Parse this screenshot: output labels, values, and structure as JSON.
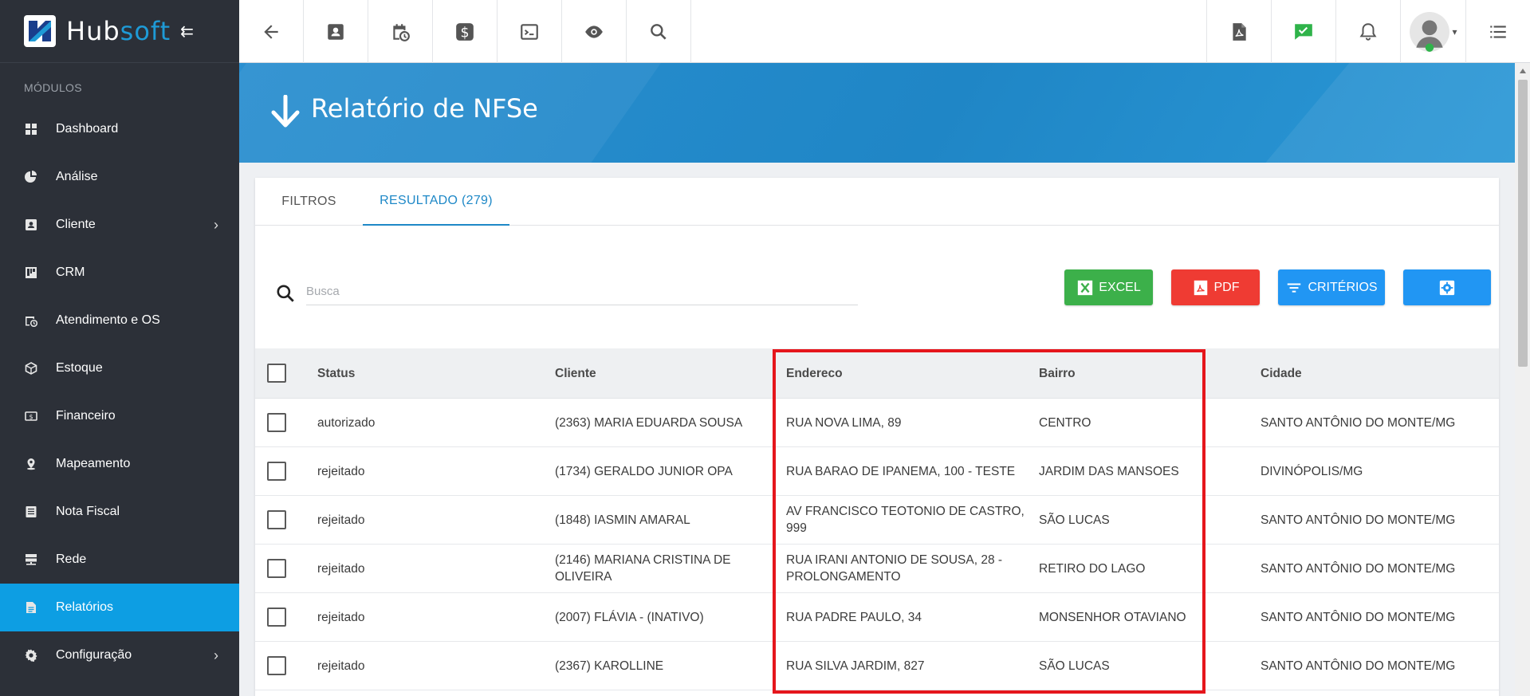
{
  "brand": {
    "name_part1": "Hub",
    "name_part2": "soft"
  },
  "sidebar": {
    "section_title": "MÓDULOS",
    "items": [
      {
        "label": "Dashboard",
        "icon": "dashboard-icon"
      },
      {
        "label": "Análise",
        "icon": "pie-chart-icon"
      },
      {
        "label": "Cliente",
        "icon": "contact-card-icon",
        "has_submenu": true
      },
      {
        "label": "CRM",
        "icon": "kanban-icon"
      },
      {
        "label": "Atendimento e OS",
        "icon": "calendar-clock-icon"
      },
      {
        "label": "Estoque",
        "icon": "box-icon"
      },
      {
        "label": "Financeiro",
        "icon": "money-icon"
      },
      {
        "label": "Mapeamento",
        "icon": "map-pin-icon"
      },
      {
        "label": "Nota Fiscal",
        "icon": "document-list-icon"
      },
      {
        "label": "Rede",
        "icon": "server-icon"
      },
      {
        "label": "Relatórios",
        "icon": "report-icon",
        "active": true
      },
      {
        "label": "Configuração",
        "icon": "gear-icon",
        "has_submenu": true
      }
    ]
  },
  "topbar": {
    "left_icons": [
      "back-arrow-icon",
      "contact-card-icon",
      "calendar-clock-icon",
      "dollar-icon",
      "terminal-icon",
      "eye-icon",
      "search-icon"
    ],
    "right_icons": [
      "pdf-file-icon",
      "chat-check-icon",
      "bell-icon",
      "user-avatar",
      "list-menu-icon"
    ]
  },
  "page": {
    "title": "Relatório de NFSe"
  },
  "tabs": [
    {
      "label": "FILTROS",
      "active": false
    },
    {
      "label": "RESULTADO (279)",
      "active": true
    }
  ],
  "toolbar": {
    "search_placeholder": "Busca",
    "excel_label": "EXCEL",
    "pdf_label": "PDF",
    "criterios_label": "CRITÉRIOS"
  },
  "table": {
    "columns": [
      "Status",
      "Cliente",
      "Endereco",
      "Bairro",
      "Cidade"
    ],
    "rows": [
      {
        "status": "autorizado",
        "cliente": "(2363) MARIA EDUARDA SOUSA",
        "endereco": "RUA NOVA LIMA, 89",
        "bairro": "CENTRO",
        "cidade": "SANTO ANTÔNIO DO MONTE/MG"
      },
      {
        "status": "rejeitado",
        "cliente": "(1734) GERALDO JUNIOR OPA",
        "endereco": "RUA BARAO DE IPANEMA, 100 - TESTE",
        "bairro": "JARDIM DAS MANSOES",
        "cidade": "DIVINÓPOLIS/MG"
      },
      {
        "status": "rejeitado",
        "cliente": "(1848) IASMIN AMARAL",
        "endereco": "AV FRANCISCO TEOTONIO DE CASTRO, 999",
        "bairro": "SÃO LUCAS",
        "cidade": "SANTO ANTÔNIO DO MONTE/MG"
      },
      {
        "status": "rejeitado",
        "cliente": "(2146) MARIANA CRISTINA DE OLIVEIRA",
        "endereco": "RUA IRANI ANTONIO DE SOUSA, 28 - PROLONGAMENTO",
        "bairro": "RETIRO DO LAGO",
        "cidade": "SANTO ANTÔNIO DO MONTE/MG"
      },
      {
        "status": "rejeitado",
        "cliente": "(2007) FLÁVIA - (INATIVO)",
        "endereco": "RUA PADRE PAULO, 34",
        "bairro": "MONSENHOR OTAVIANO",
        "cidade": "SANTO ANTÔNIO DO MONTE/MG"
      },
      {
        "status": "rejeitado",
        "cliente": "(2367) KAROLLINE",
        "endereco": "RUA SILVA JARDIM, 827",
        "bairro": "SÃO LUCAS",
        "cidade": "SANTO ANTÔNIO DO MONTE/MG"
      }
    ]
  },
  "colors": {
    "sidebar_bg": "#2c3038",
    "active_blue": "#0d9ee3",
    "highlight_red": "#e5161c",
    "excel_green": "#3cb04a",
    "pdf_red": "#ef3b33"
  }
}
